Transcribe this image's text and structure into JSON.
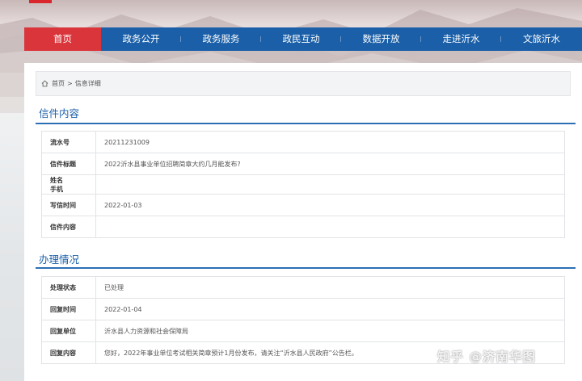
{
  "nav": {
    "items": [
      {
        "label": "首页",
        "active": true
      },
      {
        "label": "政务公开",
        "active": false
      },
      {
        "label": "政务服务",
        "active": false
      },
      {
        "label": "政民互动",
        "active": false
      },
      {
        "label": "数据开放",
        "active": false
      },
      {
        "label": "走进沂水",
        "active": false
      },
      {
        "label": "文旅沂水",
        "active": false
      }
    ]
  },
  "breadcrumb": {
    "home": "首页",
    "separator": ">",
    "current": "信息详细"
  },
  "letter": {
    "title": "信件内容",
    "rows": [
      {
        "key": "流水号",
        "value": "20211231009"
      },
      {
        "key": "信件标题",
        "value": "2022沂水县事业单位招聘简章大约几月能发布?"
      },
      {
        "key": "姓名",
        "value": ""
      },
      {
        "key": "手机",
        "value": ""
      },
      {
        "key": "写信时间",
        "value": "2022-01-03"
      },
      {
        "key": "信件内容",
        "value": ""
      }
    ]
  },
  "handling": {
    "title": "办理情况",
    "rows": [
      {
        "key": "处理状态",
        "value": "已处理"
      },
      {
        "key": "回复时间",
        "value": "2022-01-04"
      },
      {
        "key": "回复单位",
        "value": "沂水县人力资源和社会保障局"
      },
      {
        "key": "回复内容",
        "value": "您好，2022年事业单位考试相关简章预计1月份发布，请关注“沂水县人民政府”公告栏。"
      }
    ]
  },
  "watermark": "知乎 @济南华图",
  "colors": {
    "nav_bg": "#1a5fa8",
    "nav_active": "#d9353b",
    "section_title": "#1a5fa8",
    "section_line": "#2c6fb5"
  },
  "icons": {
    "home": "home-icon"
  }
}
